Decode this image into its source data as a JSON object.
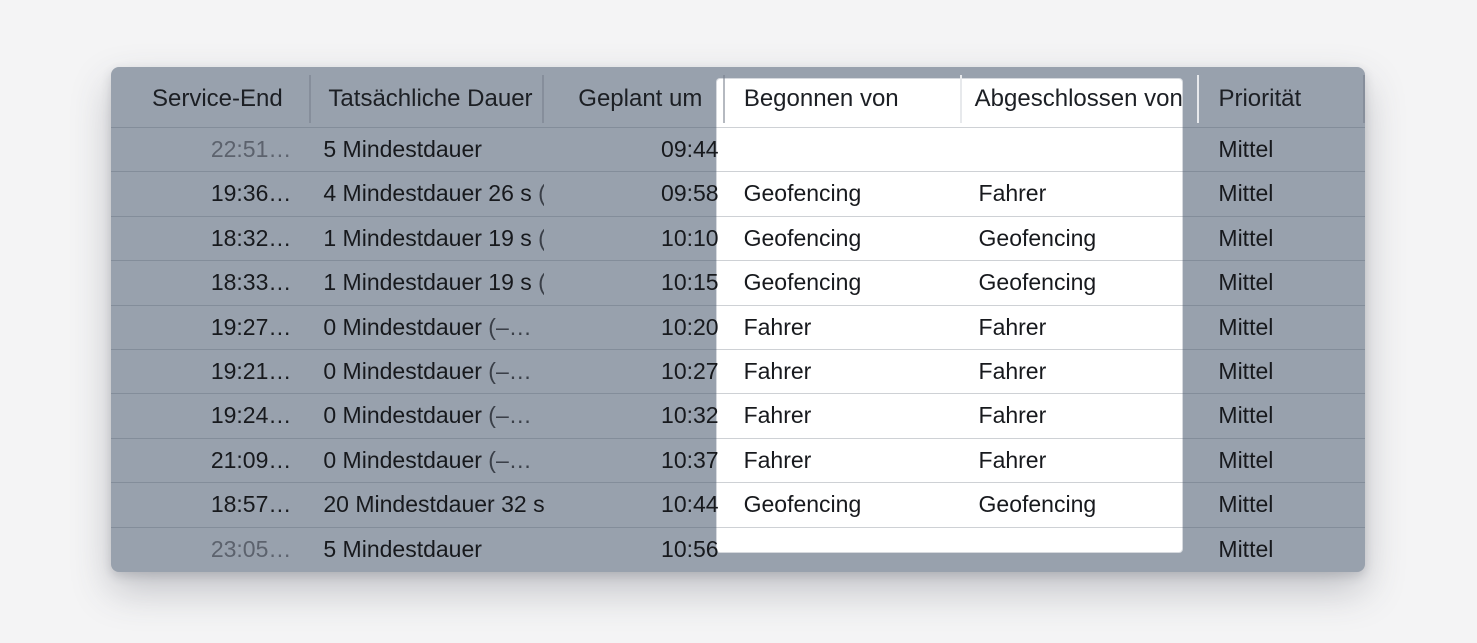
{
  "table": {
    "columns": [
      {
        "label": "Service-End"
      },
      {
        "label": "Tatsächliche Dauer"
      },
      {
        "label": "Geplant um"
      },
      {
        "label": "Begonnen von"
      },
      {
        "label": "Abgeschlossen von"
      },
      {
        "label": "Priorität"
      }
    ],
    "rows": [
      {
        "service_end": "22:51…",
        "dauer": "5 Mindestdauer",
        "dauer_tail": "",
        "geplant": "09:44",
        "begonnen": "",
        "abgeschlossen": "",
        "prioritaet": "Mittel"
      },
      {
        "service_end": "19:36…",
        "dauer": "4 Mindestdauer 26 s",
        "dauer_tail": " (–…",
        "geplant": "09:58",
        "begonnen": "Geofencing",
        "abgeschlossen": "Fahrer",
        "prioritaet": "Mittel"
      },
      {
        "service_end": "18:32…",
        "dauer": "1 Mindestdauer 19 s",
        "dauer_tail": " (–…",
        "geplant": "10:10",
        "begonnen": "Geofencing",
        "abgeschlossen": "Geofencing",
        "prioritaet": "Mittel"
      },
      {
        "service_end": "18:33…",
        "dauer": "1 Mindestdauer 19 s",
        "dauer_tail": " (–…",
        "geplant": "10:15",
        "begonnen": "Geofencing",
        "abgeschlossen": "Geofencing",
        "prioritaet": "Mittel"
      },
      {
        "service_end": "19:27…",
        "dauer": "0 Mindestdauer",
        "dauer_tail": " (–…",
        "geplant": "10:20",
        "begonnen": "Fahrer",
        "abgeschlossen": "Fahrer",
        "prioritaet": "Mittel"
      },
      {
        "service_end": "19:21…",
        "dauer": "0 Mindestdauer",
        "dauer_tail": " (–…",
        "geplant": "10:27",
        "begonnen": "Fahrer",
        "abgeschlossen": "Fahrer",
        "prioritaet": "Mittel"
      },
      {
        "service_end": "19:24…",
        "dauer": "0 Mindestdauer",
        "dauer_tail": " (–…",
        "geplant": "10:32",
        "begonnen": "Fahrer",
        "abgeschlossen": "Fahrer",
        "prioritaet": "Mittel"
      },
      {
        "service_end": "21:09…",
        "dauer": "0 Mindestdauer",
        "dauer_tail": " (–…",
        "geplant": "10:37",
        "begonnen": "Fahrer",
        "abgeschlossen": "Fahrer",
        "prioritaet": "Mittel"
      },
      {
        "service_end": "18:57…",
        "dauer": "20 Mindestdauer 32 s",
        "dauer_tail": " (+…",
        "geplant": "10:44",
        "begonnen": "Geofencing",
        "abgeschlossen": "Geofencing",
        "prioritaet": "Mittel"
      },
      {
        "service_end": "23:05…",
        "dauer": "5 Mindestdauer",
        "dauer_tail": "",
        "geplant": "10:56",
        "begonnen": "",
        "abgeschlossen": "",
        "prioritaet": "Mittel"
      }
    ]
  },
  "colors": {
    "page_background": "#f4f4f5",
    "dimmed_overlay": "#98a1ad",
    "highlight": "#ffffff",
    "text": "#17191d"
  }
}
